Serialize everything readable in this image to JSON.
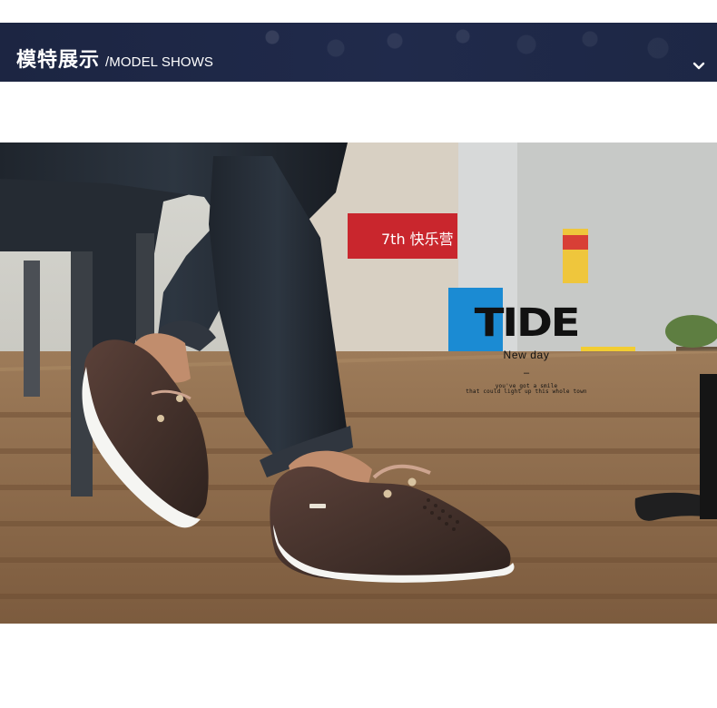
{
  "header": {
    "title_cn": "模特展示",
    "title_en": "/MODEL SHOWS",
    "collapse_icon": "chevron-down-icon"
  },
  "photo": {
    "overlay": {
      "brand": "TIDE",
      "tagline": "New day",
      "dash": "–",
      "line1": "you've got a smile",
      "line2": "that could light up this whole town"
    },
    "shop_sign": "7th 快乐营"
  },
  "colors": {
    "header_bg": "#1f2848",
    "header_text": "#ffffff",
    "accent_red": "#c9262d"
  }
}
